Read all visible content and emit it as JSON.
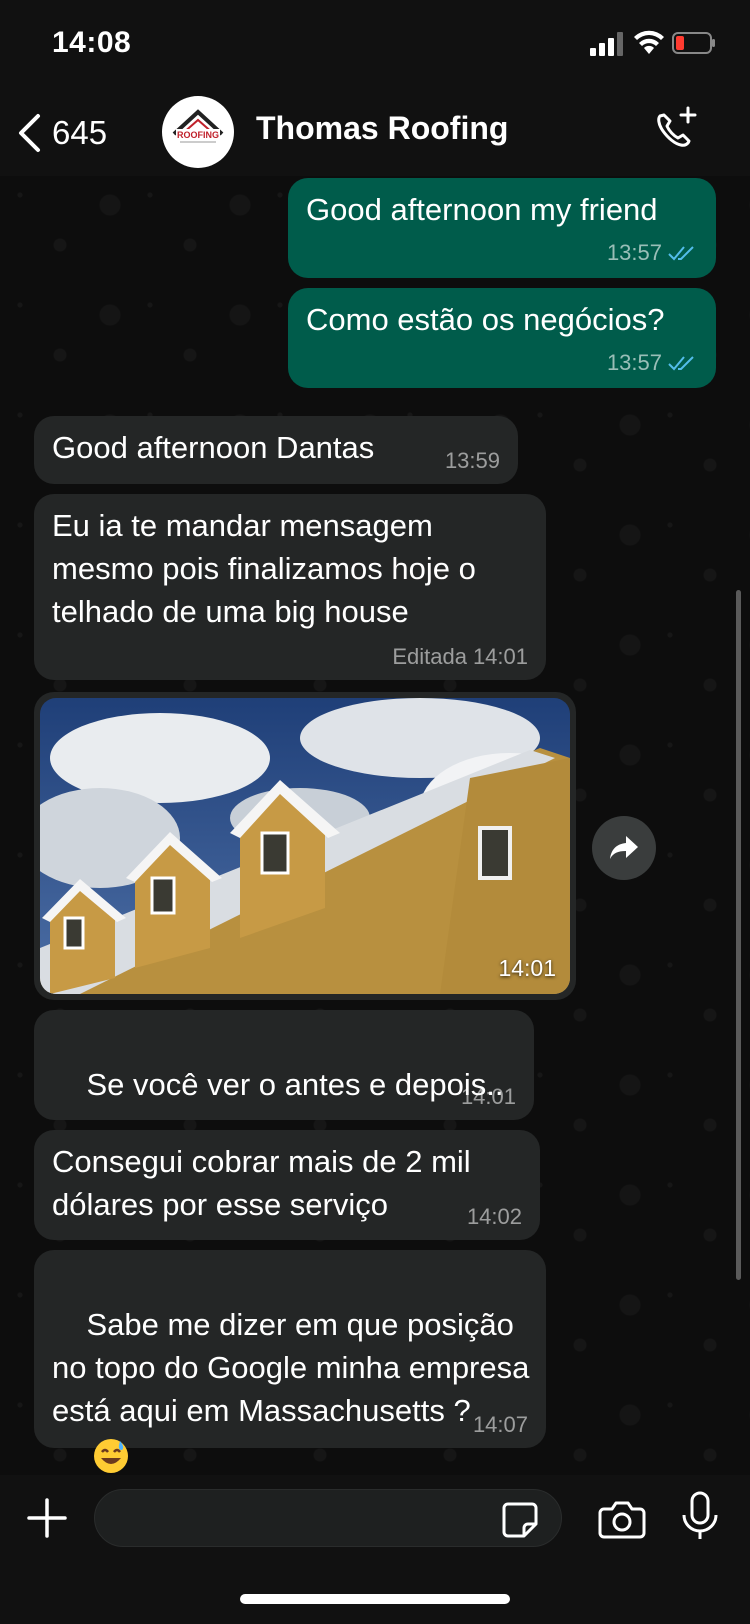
{
  "status_bar": {
    "time": "14:08"
  },
  "header": {
    "back_count": "645",
    "contact_name": "Thomas Roofing",
    "avatar_logo_text": "ROOFING"
  },
  "messages": [
    {
      "direction": "out",
      "text": "Good afternoon my friend",
      "time": "13:57",
      "read": true
    },
    {
      "direction": "out",
      "text": "Como estão os negócios?",
      "time": "13:57",
      "read": true
    },
    {
      "direction": "in",
      "text": "Good afternoon Dantas",
      "time": "13:59"
    },
    {
      "direction": "in",
      "text": "Eu ia te mandar mensagem mesmo pois finalizamos hoje o telhado de uma big house",
      "edited_label": "Editada",
      "time": "14:01"
    },
    {
      "direction": "in",
      "type": "image",
      "time": "14:01"
    },
    {
      "direction": "in",
      "text": "Se você ver o antes e depois..",
      "emoji": "😂😂",
      "time": "14:01"
    },
    {
      "direction": "in",
      "text": "Consegui cobrar mais de 2 mil dólares por esse serviço",
      "time": "14:02"
    },
    {
      "direction": "in",
      "text": "Sabe me dizer em que posição no topo do Google minha empresa está aqui em Massachusetts ?",
      "emoji": "😅",
      "time": "14:07"
    }
  ],
  "input": {
    "placeholder": ""
  },
  "colors": {
    "outgoing_bubble": "#005c4b",
    "incoming_bubble": "#242626",
    "read_ticks": "#53bdeb"
  }
}
